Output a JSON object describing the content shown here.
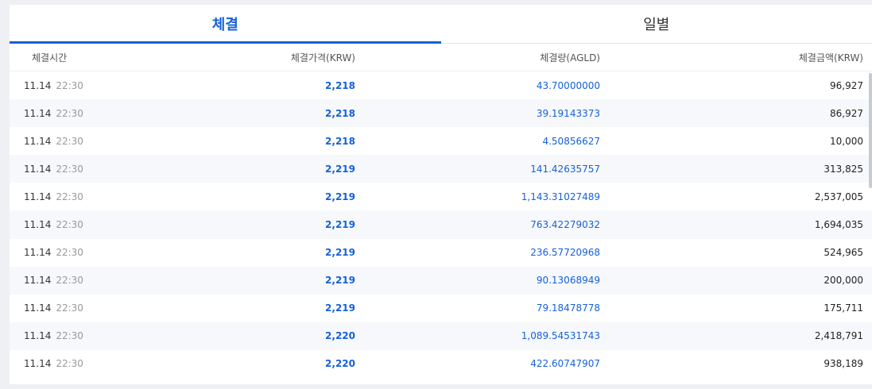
{
  "tabs": [
    {
      "label": "체결",
      "active": true
    },
    {
      "label": "일별",
      "active": false
    }
  ],
  "table": {
    "headers": {
      "time": "체결시간",
      "price": "체결가격(KRW)",
      "volume": "체결량(AGLD)",
      "amount": "체결금액(KRW)"
    },
    "rows": [
      {
        "date": "11.14",
        "time": "22:30",
        "price": "2,218",
        "volume": "43.70000000",
        "amount": "96,927"
      },
      {
        "date": "11.14",
        "time": "22:30",
        "price": "2,218",
        "volume": "39.19143373",
        "amount": "86,927"
      },
      {
        "date": "11.14",
        "time": "22:30",
        "price": "2,218",
        "volume": "4.50856627",
        "amount": "10,000"
      },
      {
        "date": "11.14",
        "time": "22:30",
        "price": "2,219",
        "volume": "141.42635757",
        "amount": "313,825"
      },
      {
        "date": "11.14",
        "time": "22:30",
        "price": "2,219",
        "volume": "1,143.31027489",
        "amount": "2,537,005"
      },
      {
        "date": "11.14",
        "time": "22:30",
        "price": "2,219",
        "volume": "763.42279032",
        "amount": "1,694,035"
      },
      {
        "date": "11.14",
        "time": "22:30",
        "price": "2,219",
        "volume": "236.57720968",
        "amount": "524,965"
      },
      {
        "date": "11.14",
        "time": "22:30",
        "price": "2,219",
        "volume": "90.13068949",
        "amount": "200,000"
      },
      {
        "date": "11.14",
        "time": "22:30",
        "price": "2,219",
        "volume": "79.18478778",
        "amount": "175,711"
      },
      {
        "date": "11.14",
        "time": "22:30",
        "price": "2,220",
        "volume": "1,089.54531743",
        "amount": "2,418,791"
      },
      {
        "date": "11.14",
        "time": "22:30",
        "price": "2,220",
        "volume": "422.60747907",
        "amount": "938,189"
      }
    ]
  },
  "colors": {
    "accent": "#1561d8",
    "text": "#222222",
    "muted": "#999999"
  }
}
